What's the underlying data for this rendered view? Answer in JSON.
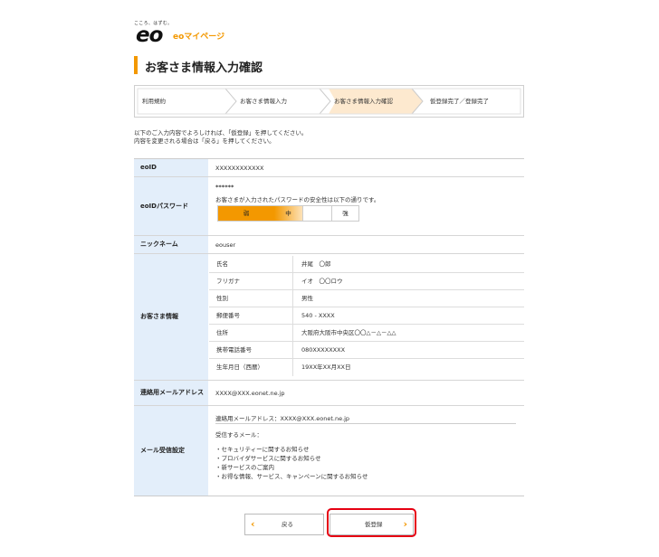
{
  "header": {
    "tagline": "こころ、はずむ。",
    "logo": "eo",
    "logo_sub": "eoマイページ",
    "accent": "#f39800"
  },
  "page_title": "お客さま情報入力確認",
  "steps": [
    "利用規約",
    "お客さま情報入力",
    "お客さま情報入力確認",
    "仮登録完了／登録完了"
  ],
  "active_step": 2,
  "intro": {
    "line1": "以下のご入力内容でよろしければ、「仮登録」を押してください。",
    "line2": "内容を変更される場合は「戻る」を押してください。"
  },
  "form": {
    "eoid": {
      "label": "eoID",
      "value": "XXXXXXXXXXXX"
    },
    "password": {
      "label": "eoIDパスワード",
      "masked": "******",
      "note": "お客さまが入力されたパスワードの安全性は以下の通りです。",
      "strength": {
        "weak": "弱",
        "mid": "中",
        "strong": "強",
        "level": "中"
      }
    },
    "nickname": {
      "label": "ニックネーム",
      "value": "eouser"
    },
    "customer": {
      "label": "お客さま情報",
      "rows": [
        {
          "label": "氏名",
          "value": "井尾　〇郎"
        },
        {
          "label": "フリガナ",
          "value": "イオ　〇〇ロウ"
        },
        {
          "label": "性別",
          "value": "男性"
        },
        {
          "label": "郵便番号",
          "value": "540 - XXXX"
        },
        {
          "label": "住所",
          "value": "大阪府大阪市中央区〇〇△－△－△△"
        },
        {
          "label": "携帯電話番号",
          "value": "080XXXXXXXX"
        },
        {
          "label": "生年月日（西暦）",
          "value": "19XX年XX月XX日"
        }
      ]
    },
    "contact_mail": {
      "label": "連絡用メールアドレス",
      "value": "XXXX@XXX.eonet.ne.jp"
    },
    "mail_settings": {
      "label": "メール受信設定",
      "address_line": "連絡用メールアドレス：XXXX@XXX.eonet.ne.jp",
      "receive_heading": "受信するメール：",
      "items": [
        "・セキュリティーに関するお知らせ",
        "・プロバイダサービスに関するお知らせ",
        "・新サービスのご案内",
        "・お得な情報、サービス、キャンペーンに関するお知らせ"
      ]
    }
  },
  "buttons": {
    "back": "戻る",
    "submit": "仮登録"
  }
}
